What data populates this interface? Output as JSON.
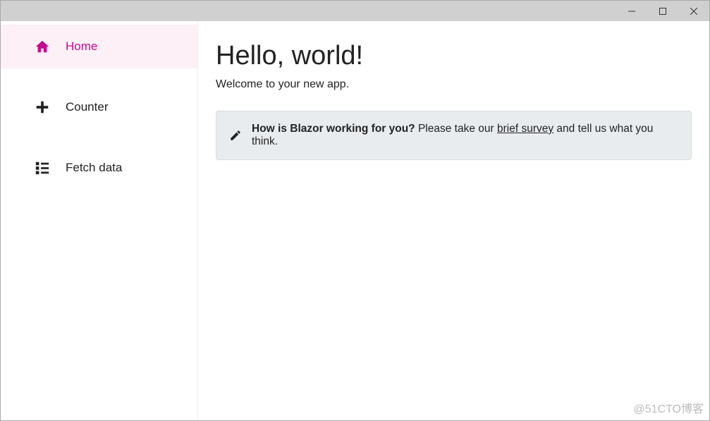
{
  "window": {
    "minimize": "—",
    "maximize": "▢",
    "close": "✕"
  },
  "sidebar": {
    "items": [
      {
        "label": "Home",
        "active": true
      },
      {
        "label": "Counter",
        "active": false
      },
      {
        "label": "Fetch data",
        "active": false
      }
    ]
  },
  "main": {
    "heading": "Hello, world!",
    "welcome": "Welcome to your new app."
  },
  "survey": {
    "prompt_bold": "How is Blazor working for you?",
    "prompt_before": " Please take our ",
    "link_text": "brief survey",
    "prompt_after": " and tell us what you think."
  },
  "watermark": "@51CTO博客"
}
